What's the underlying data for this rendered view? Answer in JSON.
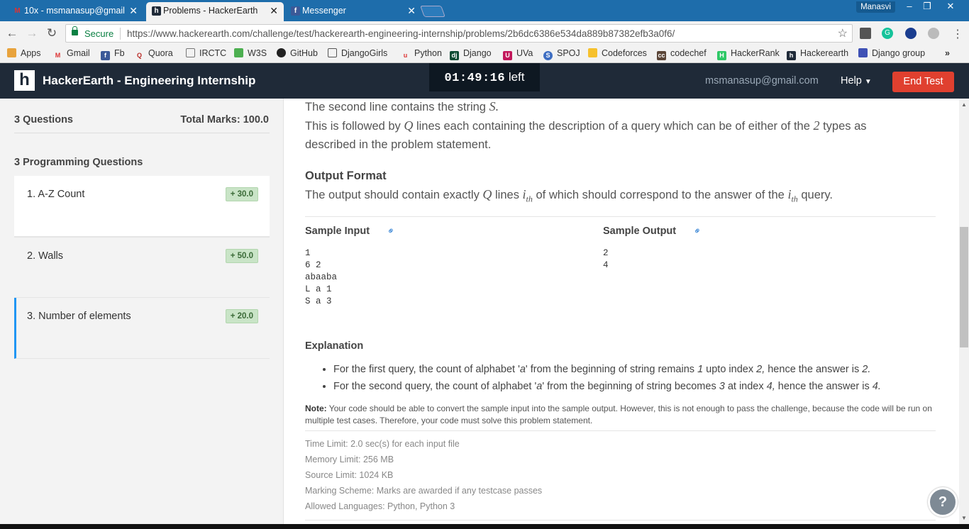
{
  "browser": {
    "tabs": [
      {
        "title": "10x - msmanasup@gmail",
        "icon": "gmail-icon"
      },
      {
        "title": "Problems - HackerEarth",
        "icon": "hackerearth-icon"
      },
      {
        "title": "Messenger",
        "icon": "facebook-icon"
      }
    ],
    "profile_name": "Manasvi",
    "secure_label": "Secure",
    "url": "https://www.hackerearth.com/challenge/test/hackerearth-engineering-internship/problems/2b6dc6386e534da889b87382efb3a0f6/",
    "bookmarks": [
      "Apps",
      "Gmail",
      "Fb",
      "Quora",
      "IRCTC",
      "W3S",
      "GitHub",
      "DjangoGirls",
      "Python",
      "Django",
      "UVa",
      "SPOJ",
      "Codeforces",
      "codechef",
      "HackerRank",
      "Hackerearth",
      "Django group"
    ]
  },
  "header": {
    "title": "HackerEarth - Engineering Internship",
    "timer_value": "01:49:16",
    "timer_suffix": "left",
    "email": "msmanasup@gmail.com",
    "help_label": "Help",
    "end_test_label": "End Test"
  },
  "sidebar": {
    "question_count": "3 Questions",
    "total_marks": "Total Marks: 100.0",
    "section_title": "3 Programming Questions",
    "questions": [
      {
        "title": "1. A-Z Count",
        "marks": "+ 30.0"
      },
      {
        "title": "2. Walls",
        "marks": "+ 50.0"
      },
      {
        "title": "3. Number of elements",
        "marks": "+ 20.0"
      }
    ]
  },
  "problem": {
    "line1_pre": "The second line contains the string ",
    "line1_var": "S.",
    "line2_pre": "This is followed by ",
    "line2_var": "Q",
    "line2_mid": " lines each containing the description of a query which can be of either of the ",
    "line2_num": "2",
    "line2_post": " types as",
    "line3": "described in the problem statement.",
    "output_heading": "Output Format",
    "output_pre": "The output should contain exactly ",
    "output_var": "Q",
    "output_mid": " lines ",
    "output_ith": "i",
    "output_sub": "th",
    "output_mid2": " of which should correspond to the answer of the ",
    "output_post": " query.",
    "sample_input_label": "Sample Input",
    "sample_output_label": "Sample Output",
    "sample_input": "1\n6 2\nabaaba\nL a 1\nS a 3",
    "sample_output": "2\n4",
    "explanation_heading": "Explanation",
    "explanation": [
      {
        "a": "For the first query, the count of alphabet '",
        "b": "a",
        "c": "' from the beginning of string remains ",
        "d": "1",
        "e": " upto index ",
        "f": "2,",
        "g": " hence the answer is ",
        "h": "2."
      },
      {
        "a": "For the second query, the count of alphabet '",
        "b": "a",
        "c": "' from the beginning of string becomes ",
        "d": "3",
        "e": " at index ",
        "f": "4,",
        "g": " hence the answer is ",
        "h": "4."
      }
    ],
    "note_label": "Note:",
    "note_text": " Your code should be able to convert the sample input into the sample output. However, this is not enough to pass the challenge, because the code will be run on multiple test cases. Therefore, your code must solve this problem statement.",
    "limits": [
      "Time Limit: 2.0 sec(s) for each input file",
      "Memory Limit: 256 MB",
      "Source Limit: 1024 KB",
      "Marking Scheme: Marks are awarded if any testcase passes",
      "Allowed Languages: Python, Python 3"
    ]
  },
  "colors": {
    "header_bg": "#1f2a38",
    "end_test": "#e0402f",
    "accent_blue": "#2196f3",
    "badge_green": "#c9e4c7"
  }
}
